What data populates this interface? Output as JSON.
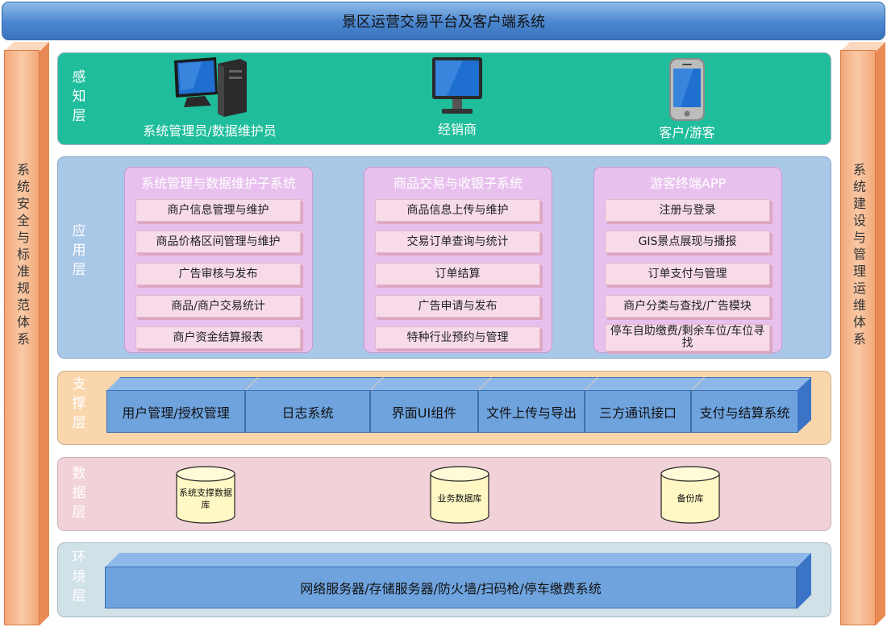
{
  "title": "景区运营交易平台及客户端系统",
  "left_pillar": "系统安全与标准规范体系",
  "right_pillar": "系统建设与管理运维体系",
  "perception": {
    "label": "感知层",
    "devices": [
      {
        "label": "系统管理员/数据维护员",
        "icon": "desktop-tower-icon"
      },
      {
        "label": "经销商",
        "icon": "monitor-icon"
      },
      {
        "label": "客户/游客",
        "icon": "mobile-phone-icon"
      }
    ]
  },
  "application": {
    "label": "应用层",
    "subsystems": [
      {
        "title": "系统管理与数据维护子系统",
        "items": [
          "商户信息管理与维护",
          "商品价格区间管理与维护",
          "广告审核与发布",
          "商品/商户交易统计",
          "商户资金结算报表"
        ]
      },
      {
        "title": "商品交易与收银子系统",
        "items": [
          "商品信息上传与维护",
          "交易订单查询与统计",
          "订单结算",
          "广告申请与发布",
          "特种行业预约与管理"
        ]
      },
      {
        "title": "游客终端APP",
        "items": [
          "注册与登录",
          "GIS景点展现与播报",
          "订单支付与管理",
          "商户分类与查找/广告模块",
          "停车自助缴费/剩余车位/车位寻找"
        ]
      }
    ]
  },
  "support": {
    "label": "支撑层",
    "modules": [
      "用户管理/授权管理",
      "日志系统",
      "界面UI组件",
      "文件上传与导出",
      "三方通讯接口",
      "支付与结算系统"
    ]
  },
  "data": {
    "label": "数据层",
    "databases": [
      "系统支撑数据库",
      "业务数据库",
      "备份库"
    ]
  },
  "environment": {
    "label": "环境层",
    "content": "网络服务器/存储服务器/防火墙/扫码枪/停车缴费系统"
  }
}
